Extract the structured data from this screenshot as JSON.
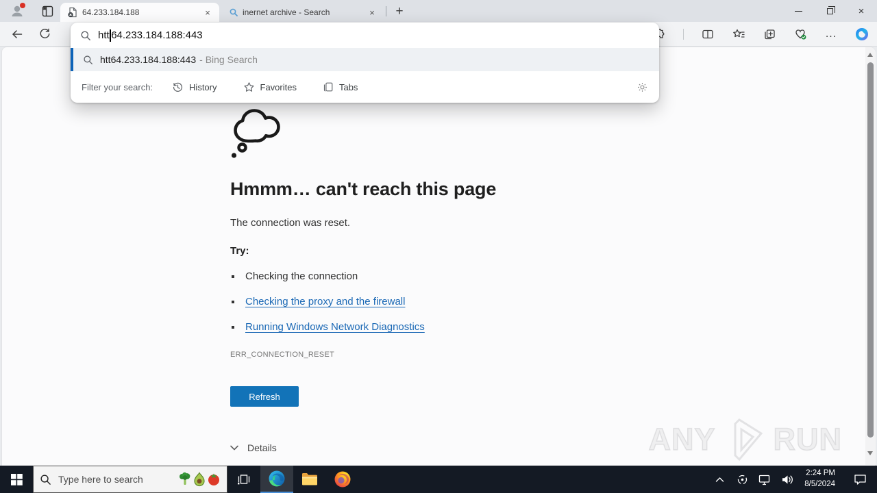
{
  "browser": {
    "tab1": {
      "title": "64.233.184.188"
    },
    "tab2": {
      "title": "inernet archive - Search"
    },
    "address": {
      "prefix": "htt",
      "suffix": "64.233.184.188:443"
    },
    "suggestion": {
      "query": "htt64.233.184.188:443",
      "annotation": "- Bing Search"
    },
    "filter": {
      "label": "Filter your search:",
      "history": "History",
      "favorites": "Favorites",
      "tabs": "Tabs"
    }
  },
  "error_page": {
    "heading": "Hmmm… can't reach this page",
    "message": "The connection was reset.",
    "try_label": "Try:",
    "suggestions": [
      "Checking the connection",
      "Checking the proxy and the firewall",
      "Running Windows Network Diagnostics"
    ],
    "error_code": "ERR_CONNECTION_RESET",
    "refresh_button": "Refresh",
    "details_label": "Details"
  },
  "watermark": {
    "word1": "ANY",
    "word2": "RUN"
  },
  "taskbar": {
    "search_placeholder": "Type here to search",
    "clock": {
      "time": "2:24 PM",
      "date": "8/5/2024"
    }
  },
  "icons": {
    "new_tab": "+",
    "close_tab": "×",
    "window_close": "×",
    "ellipsis": "..."
  },
  "colors": {
    "accent_blue": "#1273b8",
    "link_blue": "#1a68b5",
    "suggestion_accent": "#0d63b8",
    "taskbar_bg": "#141a24"
  }
}
